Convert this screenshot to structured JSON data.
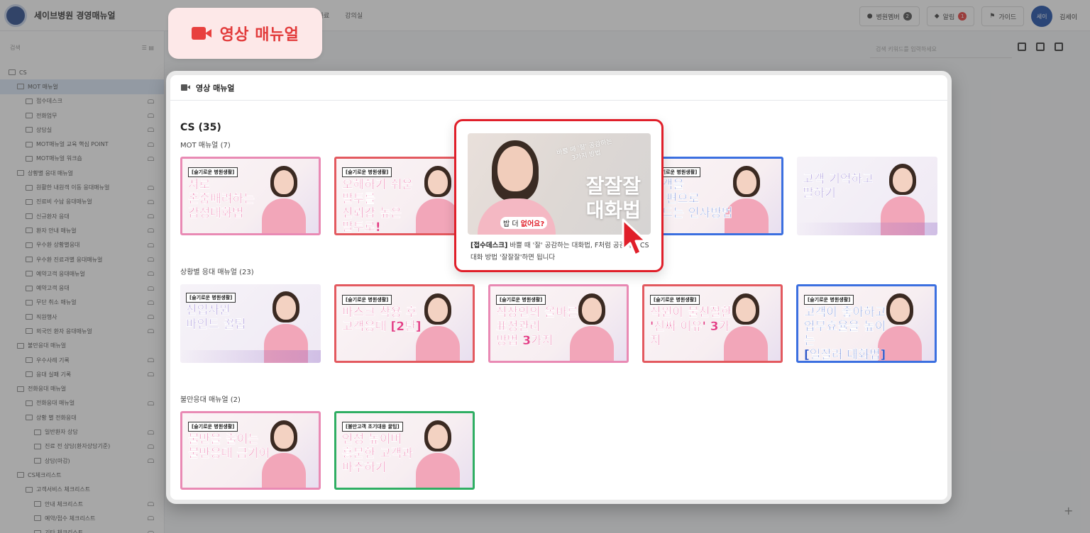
{
  "app": {
    "brand_name": "세이브병원 경영매뉴얼",
    "top_menu": [
      "학생용 자료",
      "강의실"
    ],
    "actions": [
      {
        "label": "병원멤버",
        "badge": "2",
        "badge_color": "#555555"
      },
      {
        "label": "알림",
        "badge": "1",
        "badge_color": "#e8403e"
      },
      {
        "label": "가이드",
        "badge": "",
        "badge_color": ""
      }
    ],
    "user": {
      "avatar": "세이",
      "name": "김세이"
    },
    "sidebar_search_placeholder": "검색",
    "main_search_placeholder": "검색 키워드를 입력하세요",
    "tree": [
      {
        "label": "CS",
        "indent": 0
      },
      {
        "label": "MOT 매뉴얼",
        "indent": 1,
        "selected": true
      },
      {
        "label": "접수데스크",
        "indent": 2,
        "share": true
      },
      {
        "label": "전화업무",
        "indent": 2,
        "share": true
      },
      {
        "label": "상담실",
        "indent": 2,
        "share": true
      },
      {
        "label": "MOT매뉴얼 교육 핵심 POINT",
        "indent": 2,
        "share": true
      },
      {
        "label": "MOT매뉴얼 워크숍",
        "indent": 2,
        "share": true
      },
      {
        "label": "상황별 응대 매뉴얼",
        "indent": 1
      },
      {
        "label": "원활한 내원객 이동 응대매뉴얼",
        "indent": 2,
        "share": true
      },
      {
        "label": "진료비 수납 응대매뉴얼",
        "indent": 2,
        "share": true
      },
      {
        "label": "신규환자 응대",
        "indent": 2,
        "share": true
      },
      {
        "label": "환자 안내 매뉴얼",
        "indent": 2,
        "share": true
      },
      {
        "label": "우수환 상황별응대",
        "indent": 2,
        "share": true
      },
      {
        "label": "우수환 진료과별 응대매뉴얼",
        "indent": 2,
        "share": true
      },
      {
        "label": "예약고객 응대매뉴얼",
        "indent": 2,
        "share": true
      },
      {
        "label": "예약고객 응대",
        "indent": 2,
        "share": true
      },
      {
        "label": "무단 취소 매뉴얼",
        "indent": 2,
        "share": true
      },
      {
        "label": "직원행사",
        "indent": 2,
        "share": true
      },
      {
        "label": "외국인 환자 응대매뉴얼",
        "indent": 2,
        "share": true
      },
      {
        "label": "불만응대 매뉴얼",
        "indent": 1
      },
      {
        "label": "우수사례 기록",
        "indent": 2,
        "share": true
      },
      {
        "label": "응대 실패 기록",
        "indent": 2,
        "share": true
      },
      {
        "label": "전화응대 매뉴얼",
        "indent": 1
      },
      {
        "label": "전화응대 매뉴얼",
        "indent": 2,
        "share": true
      },
      {
        "label": "상황 별 전화응대",
        "indent": 2
      },
      {
        "label": "일반환자 상담",
        "indent": 3,
        "share": true
      },
      {
        "label": "진료 전 상담(환자상담기준)",
        "indent": 3,
        "share": true
      },
      {
        "label": "상담(마감)",
        "indent": 3,
        "share": true
      },
      {
        "label": "CS체크리스트",
        "indent": 1
      },
      {
        "label": "고객서비스 체크리스트",
        "indent": 2
      },
      {
        "label": "안내 체크리스트",
        "indent": 3,
        "share": true
      },
      {
        "label": "예약/접수 체크리스트",
        "indent": 3,
        "share": true
      },
      {
        "label": "기타 체크리스트",
        "indent": 3,
        "share": true
      }
    ]
  },
  "callout": {
    "label": "영상 매뉴얼"
  },
  "modal": {
    "title": "영상 매뉴얼",
    "section_title": "CS (35)",
    "groups": [
      {
        "title": "MOT 매뉴얼 (7)"
      },
      {
        "title": "상황별 응대 매뉴얼 (23)"
      },
      {
        "title": "불만응대 매뉴얼 (2)"
      }
    ]
  },
  "videos": [
    {
      "tag": "[슬기로운 병원생활]",
      "title": "서로\n존중배려하는\n감성대화법",
      "style": "pink"
    },
    {
      "tag": "[슬기로운 병원생활]",
      "title": "오해하기 쉬운\n말투를\n신뢰감 높은\n말투로!",
      "style": "red"
    },
    {
      "tag": "[슬기로운 병원생활]",
      "title": "고객을\n내 편으로\n만드는 인사방법",
      "style": "blue"
    },
    {
      "tag": "",
      "title": "고객 기억하고\n말하기",
      "style": "none-purple"
    },
    {
      "tag": "[슬기로운 병원생활]",
      "title": "신입사원\n마인드 꿀팁",
      "style": "none-purple"
    },
    {
      "tag": "[슬기로운 병원생활]",
      "title": "마스크 착용 후\n고객응대 [2탄]",
      "style": "red"
    },
    {
      "tag": "[슬기로운 병원생활]",
      "title": "직장인의 올바른\n표정관리\n방법 3가지",
      "style": "pink"
    },
    {
      "tag": "[슬기로운 병원생활]",
      "title": "직원이 불친절한\n'진짜 이유' 3가지",
      "style": "red"
    },
    {
      "tag": "[슬기로운 병원생활]",
      "title": "고객이 좋아하고\n업무효율을 높이는\n[일잘러 대화법]",
      "style": "blue-title"
    },
    {
      "tag": "[슬기로운 병원생활]",
      "title": "불만을 줄이는\n불만응대 금기어",
      "style": "pink"
    },
    {
      "tag": "[불만고객 초기대응 꿀팁]",
      "title": "언성 높이며\n흥분한 고객과 마주하기",
      "style": "green"
    }
  ],
  "featured": {
    "subtitle": "바쁠 때 '잘' 공감하는\n3가지 방법",
    "big_text": "잘잘잘\n대화법",
    "bubble_prefix": "밥 더 ",
    "bubble_highlight": "없어요?",
    "desc_bold": "[접수데스크]",
    "desc_rest": " 바쁠 때 '잘' 공감하는 대화법, F처럼 공감하는 CS 대화 방법 '잘잘잘'하면 됩니다"
  },
  "colors": {
    "highlight_red": "#e01f2a",
    "callout_bg": "#fde8e8",
    "accent_pink": "#e23a83"
  }
}
